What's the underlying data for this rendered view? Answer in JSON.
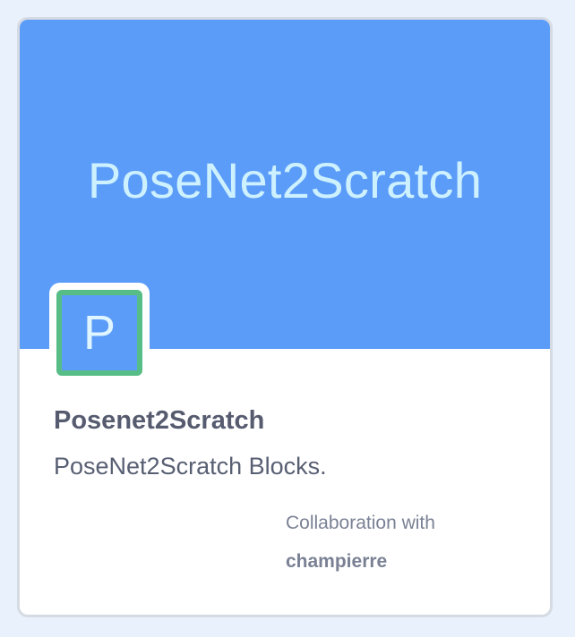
{
  "card": {
    "banner_text": "PoseNet2Scratch",
    "icon_letter": "P",
    "title": "Posenet2Scratch",
    "description": "PoseNet2Scratch Blocks.",
    "collaboration_label": "Collaboration with",
    "collaborator": "champierre"
  },
  "colors": {
    "page_background": "#e9f1fc",
    "banner": "#5c9cf9",
    "banner_text": "#cdf1ff",
    "icon_border": "#57bd86",
    "title_text": "#565b6f",
    "secondary_text": "#7a8194"
  },
  "icons": {
    "extension_icon": "letter-p-tile"
  }
}
